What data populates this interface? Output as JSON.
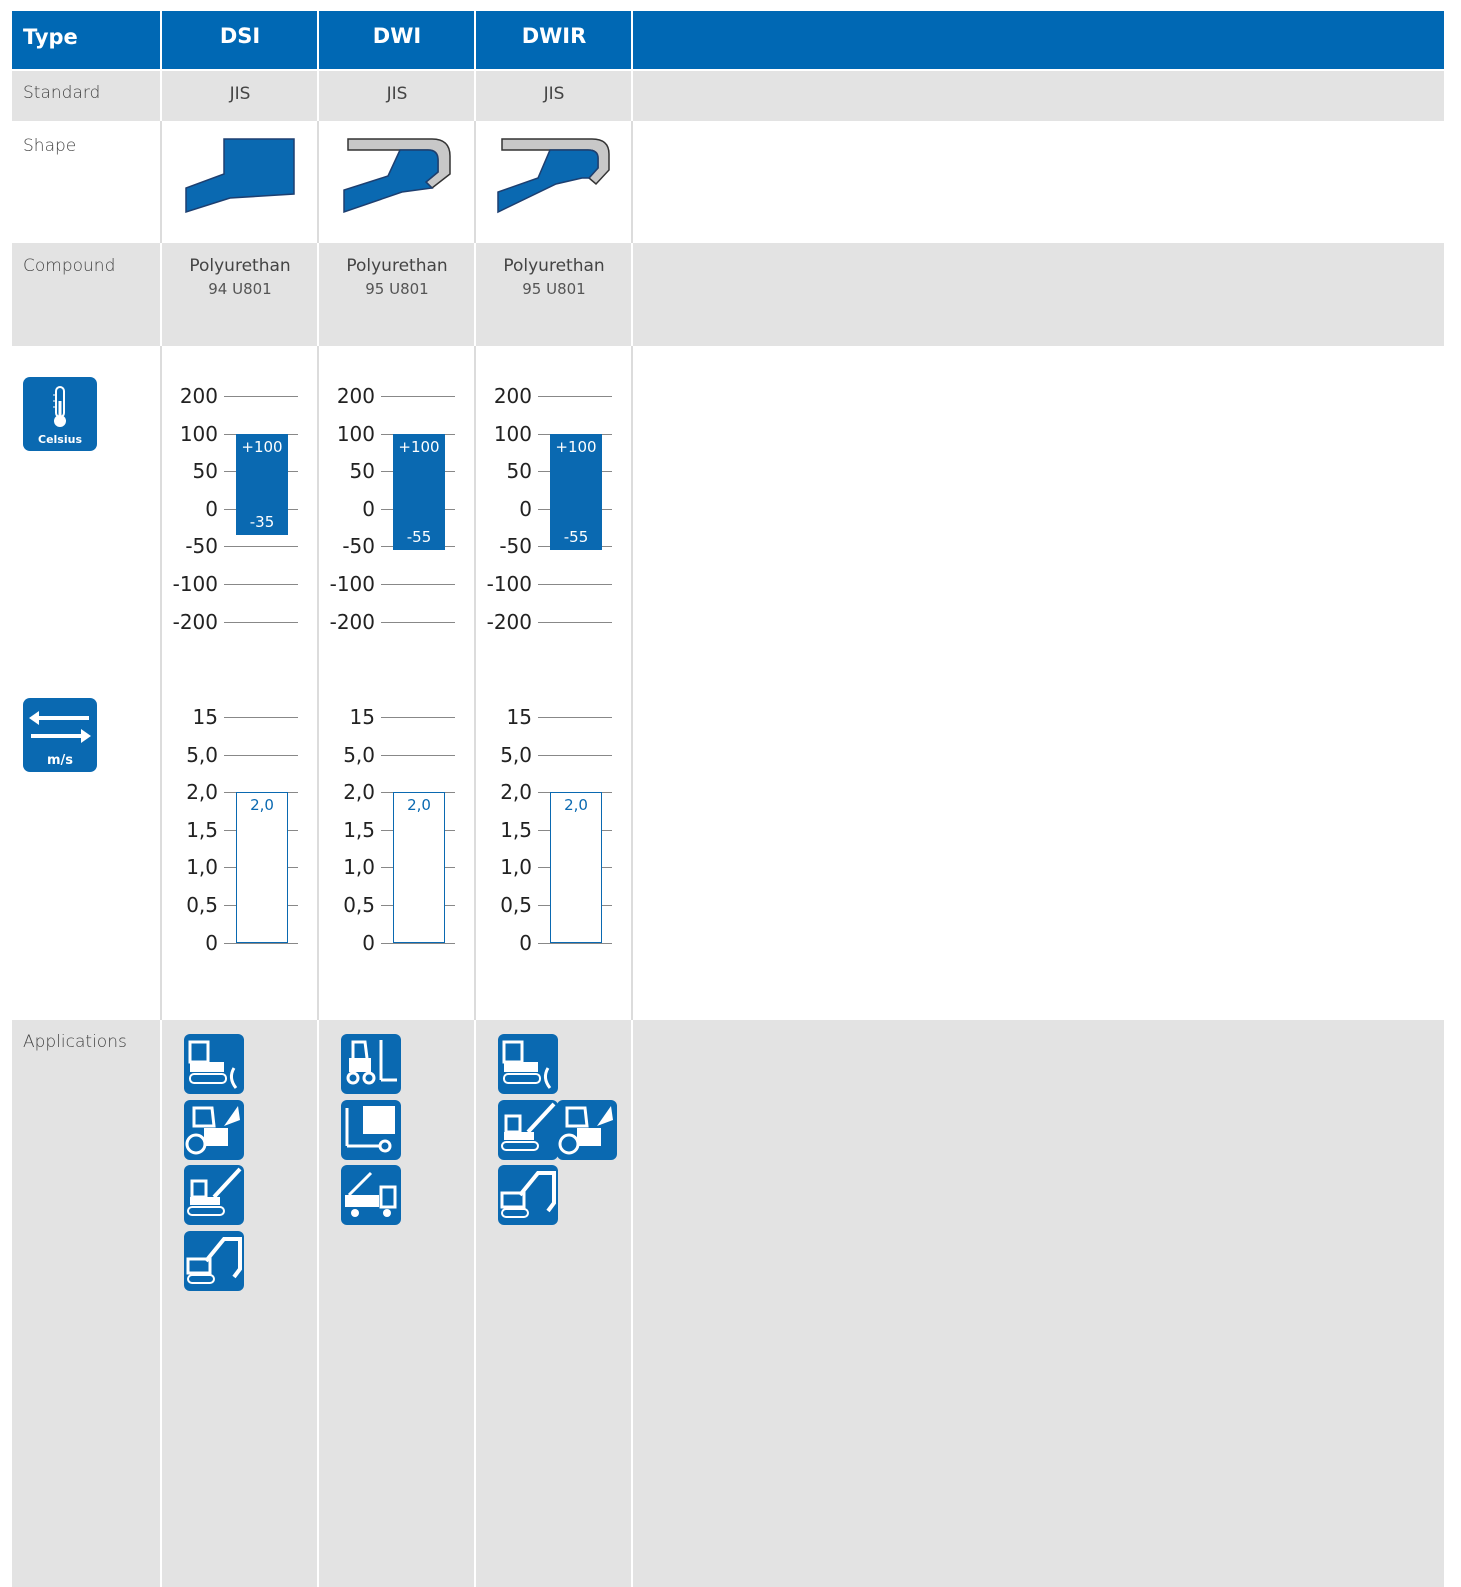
{
  "header": {
    "type_label": "Type",
    "columns": [
      "DSI",
      "DWI",
      "DWIR"
    ]
  },
  "rows": {
    "standard": {
      "label": "Standard",
      "values": [
        "JIS",
        "JIS",
        "JIS"
      ]
    },
    "shape": {
      "label": "Shape"
    },
    "compound": {
      "label": "Compound",
      "values": [
        {
          "name": "Polyurethan",
          "code": "94 U801"
        },
        {
          "name": "Polyurethan",
          "code": "95 U801"
        },
        {
          "name": "Polyurethan",
          "code": "95 U801"
        }
      ]
    },
    "applications": {
      "label": "Applications"
    }
  },
  "temperature": {
    "icon": "thermometer-icon",
    "icon_label": "Celsius",
    "ticks": [
      "200",
      "100",
      "50",
      "0",
      "-50",
      "-100",
      "-200"
    ],
    "ranges": [
      {
        "max": 100,
        "min": -35,
        "max_label": "+100",
        "min_label": "-35"
      },
      {
        "max": 100,
        "min": -55,
        "max_label": "+100",
        "min_label": "-55"
      },
      {
        "max": 100,
        "min": -55,
        "max_label": "+100",
        "min_label": "-55"
      }
    ]
  },
  "speed": {
    "icon": "speed-arrows-icon",
    "icon_label": "m/s",
    "ticks": [
      "15",
      "5,0",
      "2,0",
      "1,5",
      "1,0",
      "0,5",
      "0"
    ],
    "ranges": [
      {
        "max": 2.0,
        "label": "2,0"
      },
      {
        "max": 2.0,
        "label": "2,0"
      },
      {
        "max": 2.0,
        "label": "2,0"
      }
    ]
  },
  "applications": [
    [
      "crawler-dozer-icon",
      "wheel-loader-icon",
      "crawler-crane-icon",
      "excavator-icon"
    ],
    [
      "forklift-icon",
      "lift-platform-icon",
      "truck-crane-icon"
    ],
    [
      "crawler-dozer-icon",
      "crawler-crane-icon",
      "wheel-loader-icon",
      "excavator-icon"
    ]
  ],
  "colors": {
    "brand_blue": "#0068b4",
    "grey_row": "#e3e3e3",
    "text": "#444444"
  }
}
